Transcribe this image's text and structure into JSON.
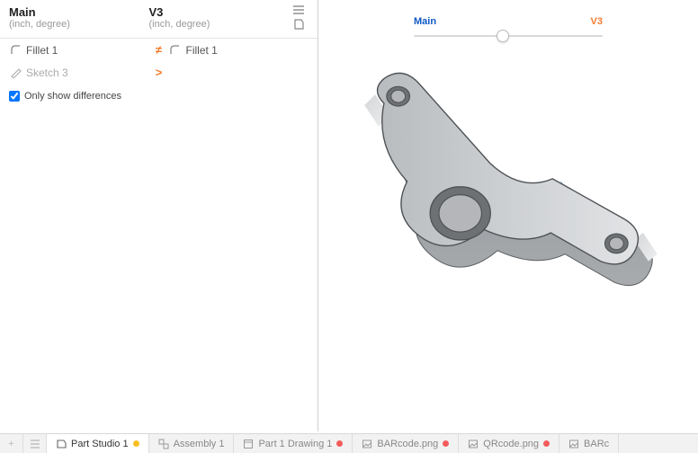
{
  "compare": {
    "left": {
      "title": "Main",
      "units": "(inch, degree)"
    },
    "right": {
      "title": "V3",
      "units": "(inch, degree)"
    },
    "rows": [
      {
        "left_icon": "fillet",
        "left_label": "Fillet 1",
        "diff": "≠",
        "right_icon": "fillet",
        "right_label": "Fillet 1"
      },
      {
        "left_icon": "sketch",
        "left_label": "Sketch 3",
        "diff": ">",
        "right_icon": "",
        "right_label": ""
      }
    ],
    "only_diff_label": "Only show differences",
    "only_diff_checked": true
  },
  "slider": {
    "left_label": "Main",
    "right_label": "V3",
    "position_pct": 47
  },
  "tabs": {
    "add_label": "+",
    "items": [
      {
        "icon": "partstudio",
        "label": "Part Studio 1",
        "dot": "amber",
        "active": true
      },
      {
        "icon": "assembly",
        "label": "Assembly 1",
        "dot": "",
        "active": false
      },
      {
        "icon": "drawing",
        "label": "Part 1 Drawing 1",
        "dot": "red",
        "active": false
      },
      {
        "icon": "image",
        "label": "BARcode.png",
        "dot": "red",
        "active": false
      },
      {
        "icon": "image",
        "label": "QRcode.png",
        "dot": "red",
        "active": false
      },
      {
        "icon": "image",
        "label": "BARc",
        "dot": "",
        "active": false
      }
    ]
  }
}
